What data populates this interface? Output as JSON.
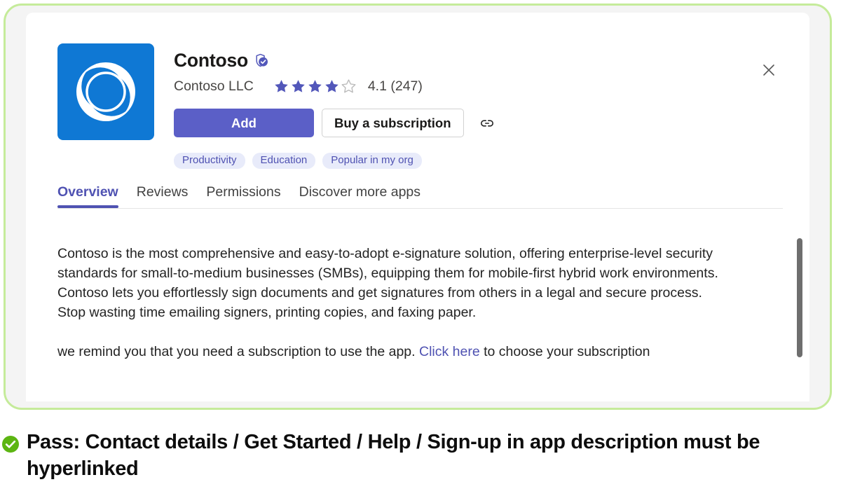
{
  "frame": {
    "border_color": "#c5eb9a",
    "backdrop_color": "#f4f4f4"
  },
  "dialog": {
    "close_label": "Close",
    "close_icon": "close-icon"
  },
  "app": {
    "icon": "contoso-app-icon",
    "name": "Contoso",
    "verified_icon": "verified-shield-icon",
    "publisher": "Contoso LLC",
    "rating": {
      "value": "4.1",
      "count": "(247)",
      "display": "4.1 (247)",
      "stars_filled": 4,
      "stars_total": 5,
      "star_color": "#5257ba",
      "star_empty_color": "#bdbdbd"
    },
    "actions": {
      "primary_label": "Add",
      "secondary_label": "Buy a subscription",
      "copy_link_icon": "link-icon"
    },
    "tags": [
      {
        "label": "Productivity"
      },
      {
        "label": "Education"
      },
      {
        "label": "Popular in my org"
      }
    ]
  },
  "tabs": [
    {
      "label": "Overview",
      "active": true
    },
    {
      "label": "Reviews",
      "active": false
    },
    {
      "label": "Permissions",
      "active": false
    },
    {
      "label": "Discover more apps",
      "active": false
    }
  ],
  "description": {
    "paragraph_1": "Contoso is the most comprehensive and easy-to-adopt e-signature solution, offering enterprise-level security standards for small-to-medium businesses (SMBs), equipping them for mobile-first hybrid work environments. Contoso lets you effortlessly sign documents and get signatures from others in a legal and secure process. Stop wasting time emailing signers, printing copies, and faxing paper.",
    "paragraph_2_before": "we remind you that  you need a subscription to use the app. ",
    "paragraph_2_link": "Click here",
    "paragraph_2_after": " to choose your subscription"
  },
  "scrollbar": {
    "thumb_color": "#6e6e6e"
  },
  "caption": {
    "status_icon": "check-circle-icon",
    "status_color": "#5cb512",
    "text": "Pass: Contact details / Get Started / Help / Sign-up in app description must be hyperlinked"
  },
  "colors": {
    "accent_purple": "#5b5fc7",
    "tab_active": "#4f52b2",
    "chip_bg": "#e8ebfa",
    "chip_text": "#4f52b2",
    "icon_blue": "#0f78d4",
    "link_blue": "#4f52b2"
  }
}
